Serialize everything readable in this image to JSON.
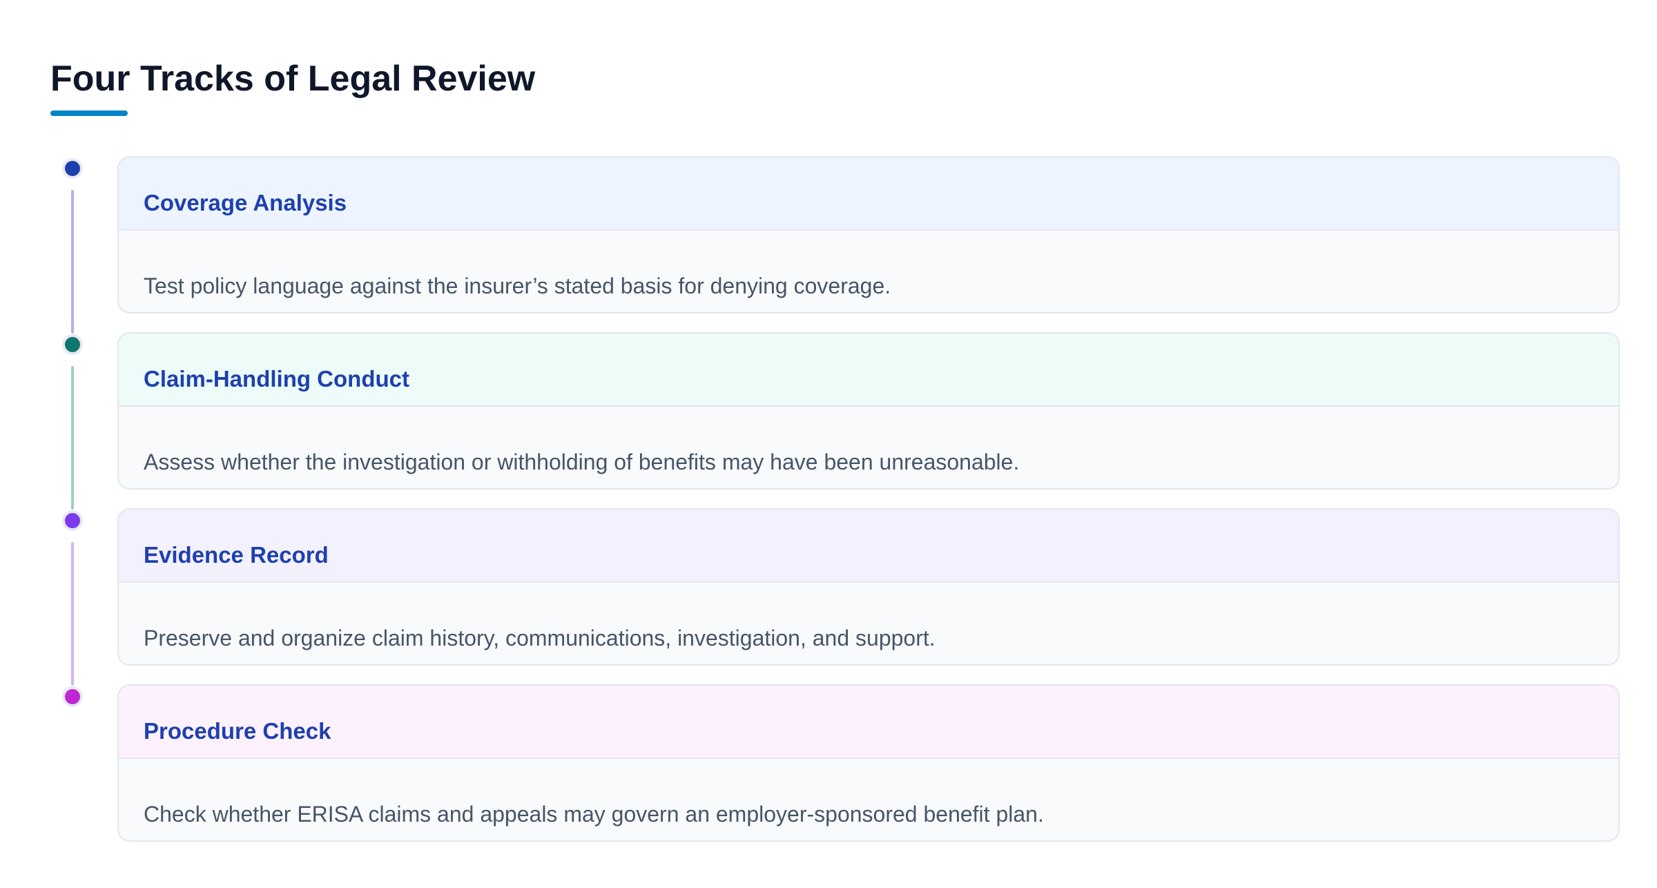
{
  "title": "Four Tracks of Legal Review",
  "accent_color": "#0284c7",
  "tracks": [
    {
      "title": "Coverage Analysis",
      "description": "Test policy language against the insurer’s stated basis for denying coverage.",
      "dot_color": "#1e40af",
      "line_color": "#b4b2ec",
      "header_bg": "#eef4ff"
    },
    {
      "title": "Claim-Handling Conduct",
      "description": "Assess whether the investigation or withholding of benefits may have been unreasonable.",
      "dot_color": "#0f766e",
      "line_color": "#9fcec6",
      "header_bg": "#edfcf8"
    },
    {
      "title": "Evidence Record",
      "description": "Preserve and organize claim history, communications, investigation, and support.",
      "dot_color": "#7c3aed",
      "line_color": "#d2b6f5",
      "header_bg": "#f4f1fe"
    },
    {
      "title": "Procedure Check",
      "description": "Check whether ERISA claims and appeals may govern an employer-sponsored benefit plan.",
      "dot_color": "#c026d3",
      "line_color": "#ebb8f0",
      "header_bg": "#fdf1fd"
    }
  ]
}
